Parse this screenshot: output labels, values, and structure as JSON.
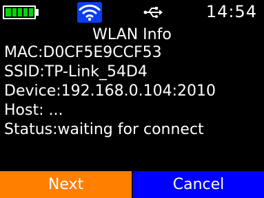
{
  "status_bar": {
    "battery_level": 1.0,
    "battery_color": "#00d800",
    "wifi_icon": "wifi-icon",
    "wifi_bg_color": "#0a3ef0",
    "usb_icon": "usb-icon",
    "time": "14:54"
  },
  "screen": {
    "title": "WLAN Info",
    "lines": {
      "mac": "MAC:D0CF5E9CCF53",
      "ssid": "SSID:TP-Link_54D4",
      "device": "Device:192.168.0.104:2010",
      "host": "Host: ...",
      "status": "Status:waiting for connect"
    }
  },
  "buttons": {
    "next_label": "Next",
    "next_color": "#ff8000",
    "cancel_label": "Cancel",
    "cancel_color": "#0000ff"
  }
}
